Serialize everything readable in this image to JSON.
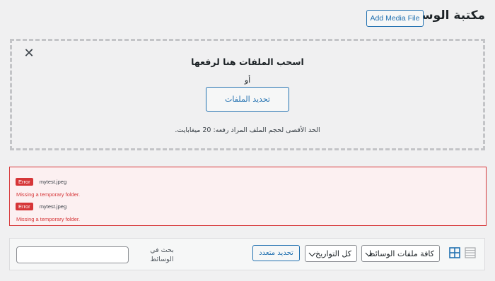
{
  "header": {
    "title": "مكتبة الوسائط",
    "add_button": "Add Media File"
  },
  "uploader": {
    "drop_title": "اسحب الملفات هنا لرفعها",
    "or_text": "أو",
    "select_button": "تحديد الملفات",
    "max_size": "الحد الأقصى لحجم الملف المراد رفعه: 20 ميغابايت."
  },
  "errors": [
    {
      "badge": "Error",
      "file": "mytest.jpeg",
      "message": "Missing a temporary folder."
    },
    {
      "badge": "Error",
      "file": "mytest.jpeg",
      "message": "Missing a temporary folder."
    }
  ],
  "toolbar": {
    "search_label": "بحث في الوسائط",
    "search_value": "",
    "bulk_select": "تحديد متعدد",
    "date_filter": "كل التواريخ",
    "type_filter": "كافة ملفات الوسائط"
  },
  "icons": {
    "close": "close-icon",
    "grid": "grid-view-icon",
    "list": "list-view-icon"
  },
  "colors": {
    "accent": "#2271b1",
    "error": "#d63638",
    "error_bg": "#fcf0f1"
  }
}
